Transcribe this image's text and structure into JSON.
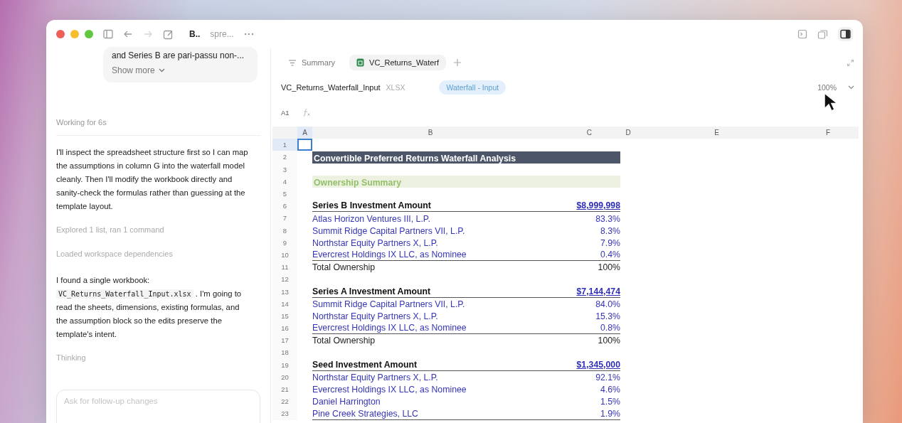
{
  "window": {
    "title": "B..",
    "subtitle": "spre..."
  },
  "chat": {
    "bubble_text": "and Series B are pari-passu non-...",
    "show_more": "Show more",
    "items": [
      {
        "kind": "status_divided",
        "text": "Working for 6s"
      },
      {
        "kind": "paragraph",
        "text": "I'll inspect the spreadsheet structure first so I can map the assumptions in column G into the waterfall model cleanly. Then I'll modify the workbook directly and sanity-check the formulas rather than guessing at the template layout."
      },
      {
        "kind": "status",
        "text": "Explored 1 list, ran 1 command"
      },
      {
        "kind": "status",
        "text": "Loaded workspace dependencies"
      },
      {
        "kind": "paragraph_with_code",
        "before": "I found a single workbook: ",
        "code": "VC_Returns_Waterfall_Input.xlsx",
        "after": " . I'm going to read the sheets, dimensions, existing formulas, and the assumption block so the edits preserve the template's intent."
      },
      {
        "kind": "status",
        "text": "Thinking"
      }
    ],
    "composer": {
      "placeholder": "Ask for follow-up changes"
    }
  },
  "sheet": {
    "tabs": [
      {
        "label": "Summary",
        "selected": false
      },
      {
        "label": "VC_Returns_Waterf",
        "selected": true
      }
    ],
    "file_name": "VC_Returns_Waterfall_Input",
    "file_type": "XLSX",
    "sheet_name": "Waterfall - Input",
    "zoom": "100%",
    "cell_ref": "A1",
    "columns": [
      {
        "label": "A",
        "selected": true
      },
      {
        "label": "B",
        "selected": false
      },
      {
        "label": "C",
        "selected": false
      },
      {
        "label": "D",
        "selected": false
      },
      {
        "label": "E",
        "selected": false
      },
      {
        "label": "F",
        "selected": false
      }
    ],
    "rows": [
      {
        "number": "1",
        "selected": true,
        "kind": "blank"
      },
      {
        "number": "2",
        "selected": false,
        "kind": "title",
        "b": "Convertible Preferred Returns Waterfall Analysis"
      },
      {
        "number": "3",
        "selected": false,
        "kind": "blank"
      },
      {
        "number": "4",
        "selected": false,
        "kind": "section",
        "b": "Ownership Summary"
      },
      {
        "number": "5",
        "selected": false,
        "kind": "blank"
      },
      {
        "number": "6",
        "selected": false,
        "kind": "header",
        "b": "Series B Investment Amount",
        "c": "$8,999,998"
      },
      {
        "number": "7",
        "selected": false,
        "kind": "investor",
        "b": "Atlas Horizon Ventures III, L.P.",
        "c": "83.3%"
      },
      {
        "number": "8",
        "selected": false,
        "kind": "investor",
        "b": "Summit Ridge Capital Partners VII, L.P.",
        "c": "8.3%"
      },
      {
        "number": "9",
        "selected": false,
        "kind": "investor",
        "b": "Northstar Equity Partners X, L.P.",
        "c": "7.9%"
      },
      {
        "number": "10",
        "selected": false,
        "kind": "investor_last",
        "b": "Evercrest Holdings IX LLC, as Nominee",
        "c": "0.4%"
      },
      {
        "number": "11",
        "selected": false,
        "kind": "total",
        "b": "Total Ownership",
        "c": "100%"
      },
      {
        "number": "12",
        "selected": false,
        "kind": "blank"
      },
      {
        "number": "13",
        "selected": false,
        "kind": "header",
        "b": "Series A Investment Amount",
        "c": "$7,144,474"
      },
      {
        "number": "14",
        "selected": false,
        "kind": "investor",
        "b": "Summit Ridge Capital Partners VII, L.P.",
        "c": "84.0%"
      },
      {
        "number": "15",
        "selected": false,
        "kind": "investor",
        "b": "Northstar Equity Partners X, L.P.",
        "c": "15.3%"
      },
      {
        "number": "16",
        "selected": false,
        "kind": "investor_last",
        "b": "Evercrest Holdings IX LLC, as Nominee",
        "c": "0.8%"
      },
      {
        "number": "17",
        "selected": false,
        "kind": "total",
        "b": "Total Ownership",
        "c": "100%"
      },
      {
        "number": "18",
        "selected": false,
        "kind": "blank"
      },
      {
        "number": "19",
        "selected": false,
        "kind": "header",
        "b": "Seed Investment Amount",
        "c": "$1,345,000"
      },
      {
        "number": "20",
        "selected": false,
        "kind": "investor",
        "b": "Northstar Equity Partners X, L.P.",
        "c": "92.1%"
      },
      {
        "number": "21",
        "selected": false,
        "kind": "investor",
        "b": "Evercrest Holdings IX LLC, as Nominee",
        "c": "4.6%"
      },
      {
        "number": "22",
        "selected": false,
        "kind": "investor",
        "b": "Daniel Harrington",
        "c": "1.5%"
      },
      {
        "number": "23",
        "selected": false,
        "kind": "investor_last",
        "b": "Pine Creek Strategies, LLC",
        "c": "1.9%"
      }
    ]
  }
}
